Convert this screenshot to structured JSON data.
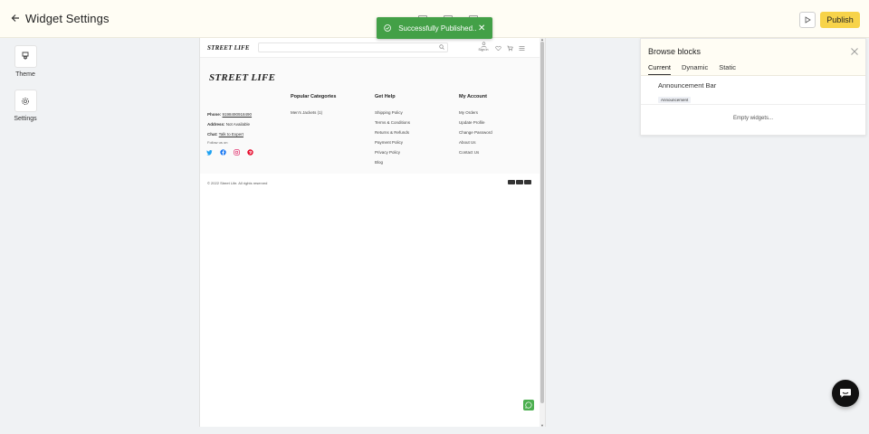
{
  "header": {
    "title": "Widget Settings",
    "publish_label": "Publish"
  },
  "toast": {
    "message": "Successfully Published..",
    "close": "✕",
    "color": "#43a047"
  },
  "rail": {
    "items": [
      {
        "label": "Theme",
        "icon": "brush-icon"
      },
      {
        "label": "Settings",
        "icon": "gear-icon"
      }
    ]
  },
  "preview": {
    "header": {
      "logo": "STREET LIFE",
      "search_placeholder": "",
      "sign_in": "Sign In"
    },
    "footer": {
      "logo": "STREET LIFE",
      "phone_label": "Phone:",
      "phone": "9198490918490",
      "address_label": "Address:",
      "address": "Not Available",
      "chat_label": "Chat:",
      "chat": "Talk to Expert",
      "follow": "Follow us on",
      "columns": [
        {
          "title": "Popular Categories",
          "links": [
            "Men's Jackets (1)"
          ]
        },
        {
          "title": "Get Help",
          "links": [
            "Shipping Policy",
            "Terms & Conditions",
            "Returns & Refunds",
            "Payment Policy",
            "Privacy Policy",
            "Blog"
          ]
        },
        {
          "title": "My Account",
          "links": [
            "My Orders",
            "Update Profile",
            "Change Password",
            "About Us",
            "Contact Us"
          ]
        }
      ],
      "copyright": "© 2022 Street Life. All rights reserved"
    }
  },
  "panel": {
    "title": "Browse blocks",
    "tabs": [
      "Current",
      "Dynamic",
      "Static"
    ],
    "active_tab": "Current",
    "block_name": "Announcement Bar",
    "block_badge": "Announcement",
    "empty": "Empty widgets..."
  },
  "colors": {
    "accent": "#f7d34a",
    "header_bg": "#fffdf4",
    "whatsapp": "#4caf50"
  }
}
